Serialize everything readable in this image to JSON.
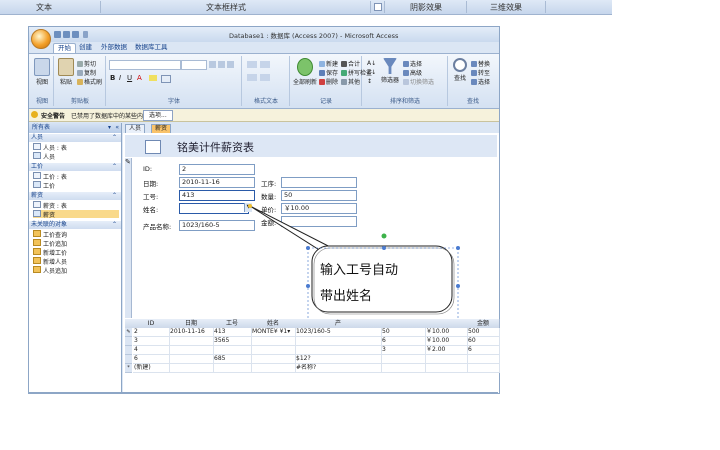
{
  "wordbar": {
    "tabs": [
      "文本",
      "文本框样式",
      "阴影效果",
      "三维效果"
    ]
  },
  "app": {
    "title": "Database1 : 数据库 (Access 2007) - Microsoft Access",
    "ribbon_tabs": [
      "开始",
      "创建",
      "外部数据",
      "数据库工具"
    ],
    "groups": [
      "视图",
      "剪贴板",
      "字体",
      "格式文本",
      "记录",
      "排序和筛选",
      "查找"
    ],
    "buttons": {
      "view": "视图",
      "paste": "粘贴",
      "cut": "剪切",
      "copy": "复制",
      "format_painter": "格式刷",
      "refresh_all": "全部刷新",
      "new": "新建",
      "save": "保存",
      "delete": "删除",
      "totals": "合计",
      "spelling": "拼写检查",
      "more": "其他",
      "filter": "筛选器",
      "selection": "选择",
      "advanced": "高级",
      "toggle_filter": "切换筛选",
      "find": "查找",
      "replace": "替换",
      "goto": "转至",
      "select": "选择"
    }
  },
  "security": {
    "label": "安全警告",
    "message": "已禁用了数据库中的某些内容",
    "options_button": "选项..."
  },
  "nav": {
    "header": "所有表",
    "sections": [
      {
        "title": "人员",
        "items": [
          {
            "label": "人员 : 表",
            "icon": "table"
          },
          {
            "label": "人员",
            "icon": "form"
          }
        ]
      },
      {
        "title": "工价",
        "items": [
          {
            "label": "工价 : 表",
            "icon": "table"
          },
          {
            "label": "工价",
            "icon": "form"
          }
        ]
      },
      {
        "title": "薪资",
        "items": [
          {
            "label": "薪资 : 表",
            "icon": "table"
          },
          {
            "label": "薪资",
            "icon": "form",
            "selected": true
          }
        ]
      },
      {
        "title": "未关联的对象",
        "items": [
          {
            "label": "工价查询",
            "icon": "query"
          },
          {
            "label": "工价追加",
            "icon": "query"
          },
          {
            "label": "新增工价",
            "icon": "query"
          },
          {
            "label": "新增人员",
            "icon": "query"
          },
          {
            "label": "人员追加",
            "icon": "query"
          }
        ]
      }
    ]
  },
  "doc_tabs": [
    "人员",
    "薪资"
  ],
  "form": {
    "title": "铭美计件薪资表",
    "fields": {
      "id_label": "ID:",
      "id_value": "2",
      "date_label": "日期:",
      "date_value": "2010-11-16",
      "workno_label": "工号:",
      "workno_value": "413",
      "name_label": "姓名:",
      "name_value": "",
      "product_label": "产品名称:",
      "product_value": "1023/160-5",
      "process_label": "工序:",
      "process_value": "",
      "qty_label": "数量:",
      "qty_value": "50",
      "price_label": "单价:",
      "price_value": "￥10.00",
      "amount_label": "金额:",
      "amount_value": ""
    }
  },
  "callout": {
    "line1": "输入工号自动",
    "line2": "带出姓名"
  },
  "grid": {
    "columns": [
      "ID",
      "日期",
      "工号",
      "姓名",
      "产",
      "",
      "",
      "",
      "金额"
    ],
    "rows": [
      {
        "selector": "✎",
        "cells": [
          "2",
          "2010-11-16",
          "413",
          "MONTE¥ ¥1▾",
          "1023/160-5",
          "50",
          "￥10.00",
          "500"
        ]
      },
      {
        "selector": "",
        "cells": [
          "3",
          "",
          "3565",
          "",
          "",
          "6",
          "￥10.00",
          "60"
        ]
      },
      {
        "selector": "",
        "cells": [
          "4",
          "",
          "",
          "",
          "",
          "3",
          "￥2.00",
          "6"
        ]
      },
      {
        "selector": "",
        "cells": [
          "6",
          "",
          "685",
          "",
          "$12?",
          "",
          "",
          ""
        ]
      },
      {
        "selector": "*",
        "cells": [
          "(新建)",
          "",
          "",
          "",
          "#名称?",
          "",
          "",
          ""
        ]
      }
    ]
  },
  "colors": {
    "accent": "#f3a12b",
    "ribbon": "#dbe6f4",
    "selected": "#f9d98a"
  }
}
